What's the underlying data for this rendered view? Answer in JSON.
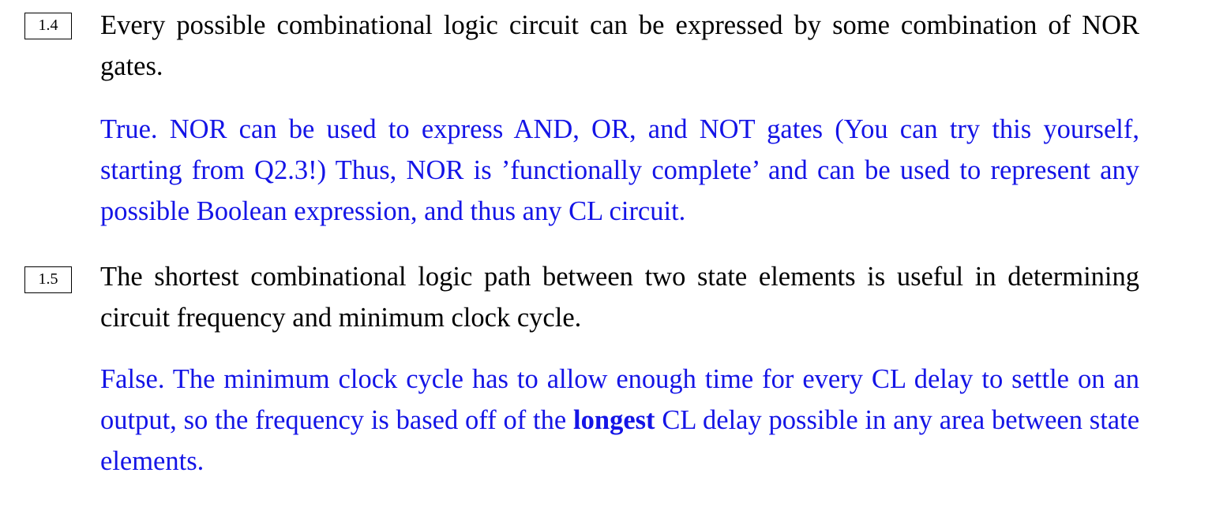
{
  "items": [
    {
      "number": "1.4",
      "question": "Every possible combinational logic circuit can be expressed by some combination of NOR gates.",
      "answer": "True. NOR can be used to express AND, OR, and NOT gates (You can try this yourself, starting from Q2.3!) Thus, NOR is ’functionally complete’ and can be used to represent any possible Boolean expression, and thus any CL circuit."
    },
    {
      "number": "1.5",
      "question": "The shortest combinational logic path between two state elements is useful in determining circuit frequency and minimum clock cycle.",
      "answer_before_bold": "False. The minimum clock cycle has to allow enough time for every CL delay to settle on an output, so the frequency is based off of the ",
      "answer_bold": "longest",
      "answer_after_bold": " CL delay possible in any area between state elements."
    }
  ],
  "colors": {
    "answer_text": "#1414e6",
    "question_text": "#000000"
  }
}
